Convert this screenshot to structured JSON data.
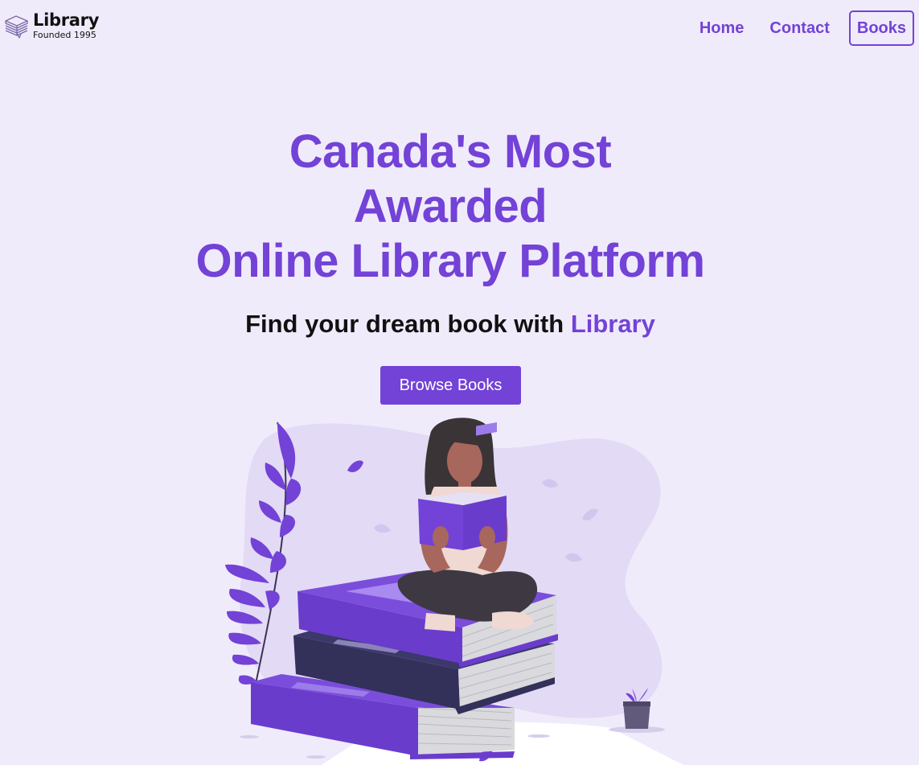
{
  "brand": {
    "title": "Library",
    "subtitle": "Founded 1995",
    "icon": "stacked-books-icon"
  },
  "nav": {
    "items": [
      {
        "label": "Home",
        "boxed": false
      },
      {
        "label": "Contact",
        "boxed": false
      },
      {
        "label": "Books",
        "boxed": true
      }
    ]
  },
  "hero": {
    "title_line1": "Canada's Most Awarded",
    "title_line2": "Online Library Platform",
    "subtitle_prefix": "Find your dream book with ",
    "subtitle_accent": "Library",
    "cta_label": "Browse Books"
  },
  "colors": {
    "accent": "#7342d6",
    "background": "#f0ebfb",
    "text": "#111111"
  },
  "illustration": {
    "icon": "woman-reading-on-books-illustration"
  }
}
